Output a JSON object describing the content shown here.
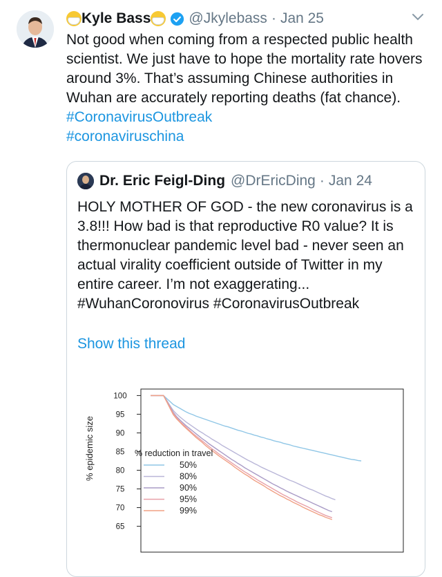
{
  "tweet": {
    "author_name": "Kyle Bass",
    "handle": "@Jkylebass",
    "separator": "·",
    "date": "Jan 25",
    "text": "Not good when coming from a respected public health scientist. We just have to hope the mortality rate hovers around 3%. That’s assuming Chinese authorities in Wuhan are accurately reporting deaths (fat chance).",
    "hashtag1": "#CoronavirusOutbreak",
    "hashtag2": "#coronaviruschina"
  },
  "quoted": {
    "author_name": "Dr. Eric Feigl-Ding",
    "handle": "@DrEricDing",
    "separator": "·",
    "date": "Jan 24",
    "text": "HOLY MOTHER OF GOD - the new coronavirus is a 3.8!!! How bad is that reproductive R0 value? It is thermonuclear pandemic level bad - never seen an actual virality coefficient outside of Twitter in my entire career. I’m not exaggerating... #WuhanCoronovirus #CoronavirusOutbreak",
    "show_thread": "Show this thread"
  },
  "icons": {
    "verified": "verified-badge-icon",
    "caret": "chevron-down-icon",
    "emoji": "face-with-medical-mask-icon"
  },
  "colors": {
    "link": "#1b95e0",
    "verified": "#1da1f2",
    "muted": "#657786"
  },
  "chart_data": {
    "type": "line",
    "ylabel": "% epidemic size",
    "yticks": [
      100,
      95,
      90,
      85,
      80,
      75,
      70,
      65
    ],
    "ylim": [
      64,
      101
    ],
    "x": [
      0,
      1,
      2,
      3,
      4,
      5,
      6,
      7,
      8,
      9,
      10,
      11,
      12,
      13,
      14,
      15,
      16,
      17,
      18,
      19,
      20,
      21,
      22,
      23,
      24,
      25,
      26,
      27,
      28,
      29,
      30,
      31,
      32,
      33,
      34,
      35,
      36,
      37,
      38,
      39,
      40,
      41,
      42,
      43,
      44,
      45,
      46,
      47,
      48,
      49,
      50,
      51,
      52,
      53,
      54,
      55,
      56,
      57,
      58,
      59,
      60,
      61,
      62,
      63,
      64,
      65,
      66,
      67,
      68,
      69,
      70,
      71,
      72,
      73,
      74,
      75
    ],
    "legend_title": "% reduction in travel",
    "legend_placement": "bottom-left",
    "series": [
      {
        "name": "50%",
        "color": "#8fc6e6",
        "values": [
          100,
          100,
          100,
          100,
          100,
          99.2,
          98.4,
          97.6,
          97.1,
          96.6,
          96.1,
          95.6,
          95.2,
          94.9,
          94.5,
          94.2,
          93.9,
          93.6,
          93.3,
          93.0,
          92.7,
          92.4,
          92.1,
          91.8,
          91.6,
          91.3,
          91.0,
          90.7,
          90.5,
          90.2,
          89.9,
          89.7,
          89.4,
          89.2,
          88.9,
          88.7,
          88.4,
          88.2,
          87.9,
          87.7,
          87.5,
          87.2,
          87.0,
          86.8,
          86.5,
          86.3,
          86.1,
          85.9,
          85.7,
          85.5,
          85.3,
          85.1,
          84.9,
          84.7,
          84.5,
          84.3,
          84.1,
          83.9,
          83.7,
          83.5,
          83.3,
          83.1,
          82.9,
          82.8,
          82.6,
          82.5
        ]
      },
      {
        "name": "80%",
        "color": "#b9b6d8",
        "values": [
          100,
          100,
          100,
          100,
          100,
          98.7,
          97.3,
          96.0,
          95.1,
          94.3,
          93.6,
          92.9,
          92.3,
          91.7,
          91.1,
          90.5,
          90.0,
          89.4,
          88.9,
          88.3,
          87.8,
          87.3,
          86.7,
          86.2,
          85.7,
          85.2,
          84.7,
          84.2,
          83.7,
          83.2,
          82.7,
          82.3,
          81.8,
          81.4,
          80.9,
          80.5,
          80.1,
          79.7,
          79.3,
          78.9,
          78.5,
          78.1,
          77.7,
          77.3,
          77.0,
          76.6,
          76.2,
          75.8,
          75.4,
          75.0,
          74.7,
          74.3,
          73.9,
          73.5,
          73.1,
          72.8,
          72.4,
          72.1
        ]
      },
      {
        "name": "90%",
        "color": "#a99bc6",
        "values": [
          100,
          100,
          100,
          100,
          100,
          98.5,
          97.0,
          95.5,
          94.4,
          93.5,
          92.7,
          91.9,
          91.2,
          90.5,
          89.8,
          89.1,
          88.4,
          87.8,
          87.1,
          86.5,
          85.9,
          85.3,
          84.7,
          84.1,
          83.5,
          82.9,
          82.4,
          81.8,
          81.3,
          80.7,
          80.2,
          79.7,
          79.2,
          78.7,
          78.2,
          77.7,
          77.2,
          76.7,
          76.2,
          75.8,
          75.3,
          74.9,
          74.4,
          74.0,
          73.6,
          73.2,
          72.8,
          72.4,
          72.0,
          71.6,
          71.2,
          70.8,
          70.4,
          70.0,
          69.6,
          69.2,
          68.9
        ]
      },
      {
        "name": "95%",
        "color": "#e8a0a8",
        "values": [
          100,
          100,
          100,
          100,
          100,
          98.4,
          96.8,
          95.2,
          94.1,
          93.1,
          92.3,
          91.5,
          90.7,
          89.9,
          89.2,
          88.5,
          87.8,
          87.1,
          86.4,
          85.7,
          85.1,
          84.4,
          83.8,
          83.2,
          82.6,
          82.0,
          81.4,
          80.8,
          80.2,
          79.6,
          79.1,
          78.5,
          78.0,
          77.4,
          76.9,
          76.4,
          75.9,
          75.4,
          74.9,
          74.4,
          73.9,
          73.4,
          73.0,
          72.5,
          72.1,
          71.6,
          71.2,
          70.8,
          70.4,
          70.0,
          69.5,
          69.1,
          68.7,
          68.3,
          67.9,
          67.6,
          67.3
        ]
      },
      {
        "name": "99%",
        "color": "#f0a084",
        "values": [
          100,
          100,
          100,
          100,
          100,
          98.3,
          96.6,
          94.9,
          93.8,
          92.9,
          92.0,
          91.2,
          90.4,
          89.6,
          88.8,
          88.1,
          87.4,
          86.6,
          85.9,
          85.2,
          84.6,
          83.9,
          83.3,
          82.7,
          82.1,
          81.5,
          80.8,
          80.2,
          79.6,
          79.0,
          78.5,
          77.9,
          77.3,
          76.8,
          76.3,
          75.8,
          75.2,
          74.7,
          74.2,
          73.7,
          73.2,
          72.8,
          72.3,
          71.9,
          71.4,
          71.0,
          70.6,
          70.1,
          69.7,
          69.3,
          68.9,
          68.5,
          68.1,
          67.8,
          67.4,
          67.1,
          66.8
        ]
      }
    ]
  }
}
